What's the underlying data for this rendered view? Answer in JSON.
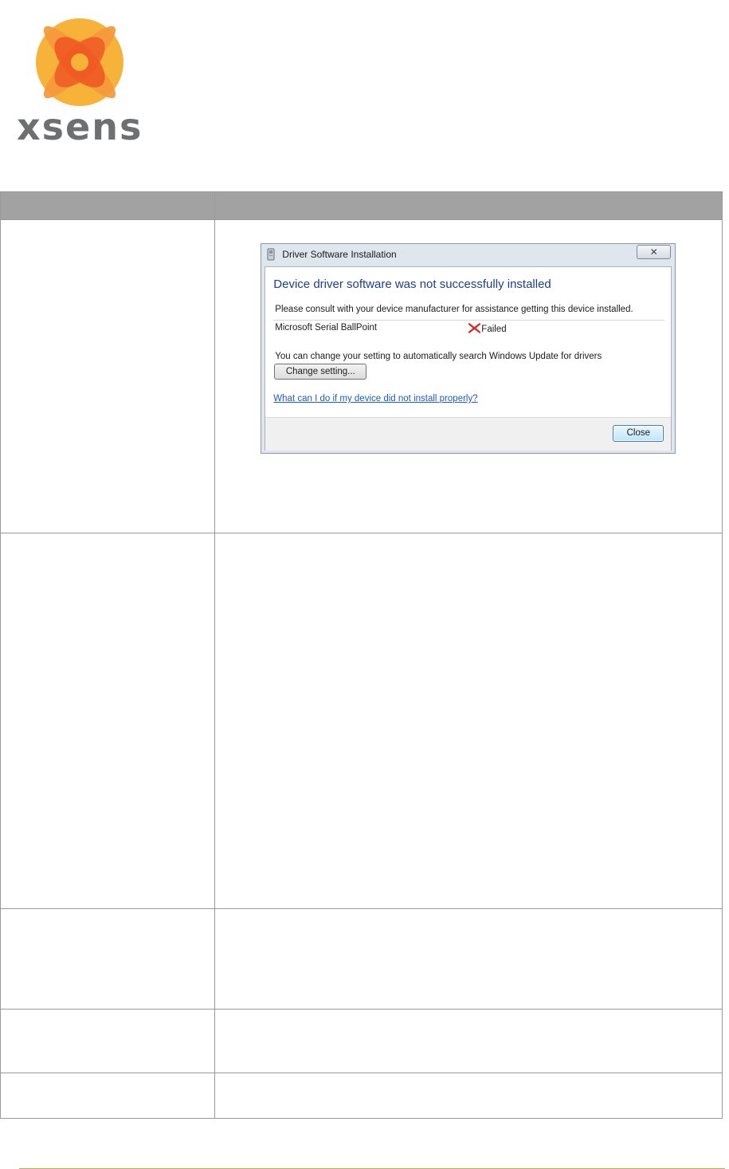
{
  "logo": {
    "wordmark": "xsens",
    "colors": {
      "outer_circle": "#f7b23a",
      "petal_dark": "#f05a24",
      "petal_light": "#f59a3b",
      "wordmark": "#6e6f71"
    }
  },
  "table": {
    "header_color": "#a2a2a2",
    "border_color": "#9a9a9a"
  },
  "dialog": {
    "title": "Driver Software Installation",
    "close_glyph": "✕",
    "heading": "Device driver software was not successfully installed",
    "consult_text": "Please consult with your device manufacturer for assistance getting this device installed.",
    "device_name": "Microsoft Serial BallPoint",
    "status": "Failed",
    "setting_text": "You can change your setting to automatically search Windows Update for drivers",
    "change_button": "Change setting...",
    "help_link": "What can I do if my device did not install properly?",
    "close_button": "Close",
    "heading_color": "#1a3e93",
    "link_color": "#1a5cc4",
    "fail_color": "#d9262b"
  },
  "footer": {
    "rule_color": "#c9a84c"
  }
}
